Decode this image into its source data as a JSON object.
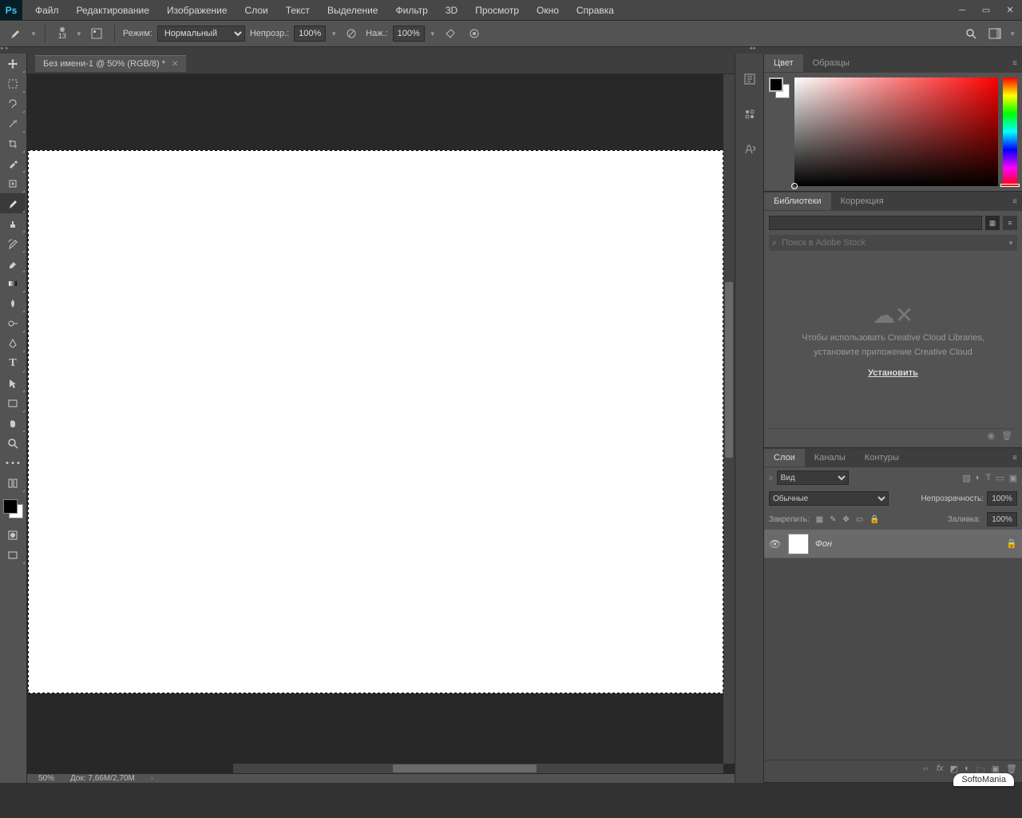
{
  "app_logo": "Ps",
  "menu": [
    "Файл",
    "Редактирование",
    "Изображение",
    "Слои",
    "Текст",
    "Выделение",
    "Фильтр",
    "3D",
    "Просмотр",
    "Окно",
    "Справка"
  ],
  "options": {
    "brush_size": "13",
    "mode_label": "Режим:",
    "mode_value": "Нормальный",
    "opacity_label": "Непрозр.:",
    "opacity_value": "100%",
    "flow_label": "Наж.:",
    "flow_value": "100%"
  },
  "document": {
    "tab_title": "Без имени-1 @ 50% (RGB/8) *",
    "zoom": "50%",
    "doc_label": "Док:",
    "doc_size": "7,66M/2,70M"
  },
  "panels": {
    "color": {
      "tabs": [
        "Цвет",
        "Образцы"
      ],
      "active": 0
    },
    "libraries": {
      "tabs": [
        "Библиотеки",
        "Коррекция"
      ],
      "active": 0,
      "search_placeholder": "Поиск в Adobe Stock",
      "msg1": "Чтобы использовать Creative Cloud Libraries,",
      "msg2": "установите приложение Creative Cloud",
      "install": "Установить"
    },
    "layers": {
      "tabs": [
        "Слои",
        "Каналы",
        "Контуры"
      ],
      "active": 0,
      "kind_placeholder": "Вид",
      "blend_value": "Обычные",
      "opacity_label": "Непрозрачность:",
      "opacity_value": "100%",
      "lock_label": "Закрепить:",
      "fill_label": "Заливка:",
      "fill_value": "100%",
      "layer_name": "Фон"
    }
  },
  "watermark": "SoftoMania"
}
